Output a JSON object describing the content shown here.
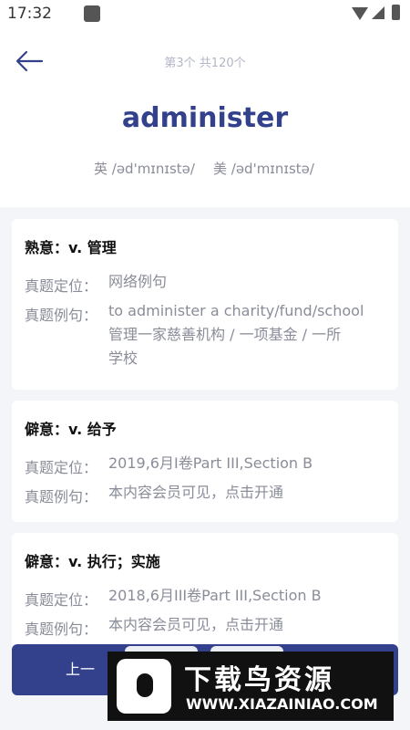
{
  "status_bar": {
    "time": "17:32"
  },
  "header": {
    "counter": "第3个 共120个",
    "word": "administer",
    "phonetic_uk": "英 /əd'mɪnɪstə/",
    "phonetic_us": "美 /əd'mɪnɪstə/"
  },
  "cards": [
    {
      "title": "熟意：v. 管理",
      "location_label": "真题定位：",
      "location": "网络例句",
      "example_label": "真题例句：",
      "example_lines": [
        "to administer a charity/fund/school",
        "管理一家慈善机构 / 一项基金 / 一所",
        "学校"
      ]
    },
    {
      "title": "僻意：v. 给予",
      "location_label": "真题定位：",
      "location": "2019,6月I卷Part III,Section B",
      "example_label": "真题例句：",
      "example": "本内容会员可见，点击开通"
    },
    {
      "title": "僻意：v. 执行；实施",
      "location_label": "真题定位：",
      "location": "2018,6月III卷Part III,Section B",
      "example_label": "真题例句：",
      "example": "本内容会员可见，点击开通"
    }
  ],
  "bottom": {
    "prev_label": "上一"
  },
  "watermark": {
    "title": "下载鸟资源",
    "url": "WWW.XIAZAINIAO.COM"
  },
  "colors": {
    "accent": "#33418c",
    "muted": "#8a8d99",
    "background": "#f4f5f9"
  }
}
